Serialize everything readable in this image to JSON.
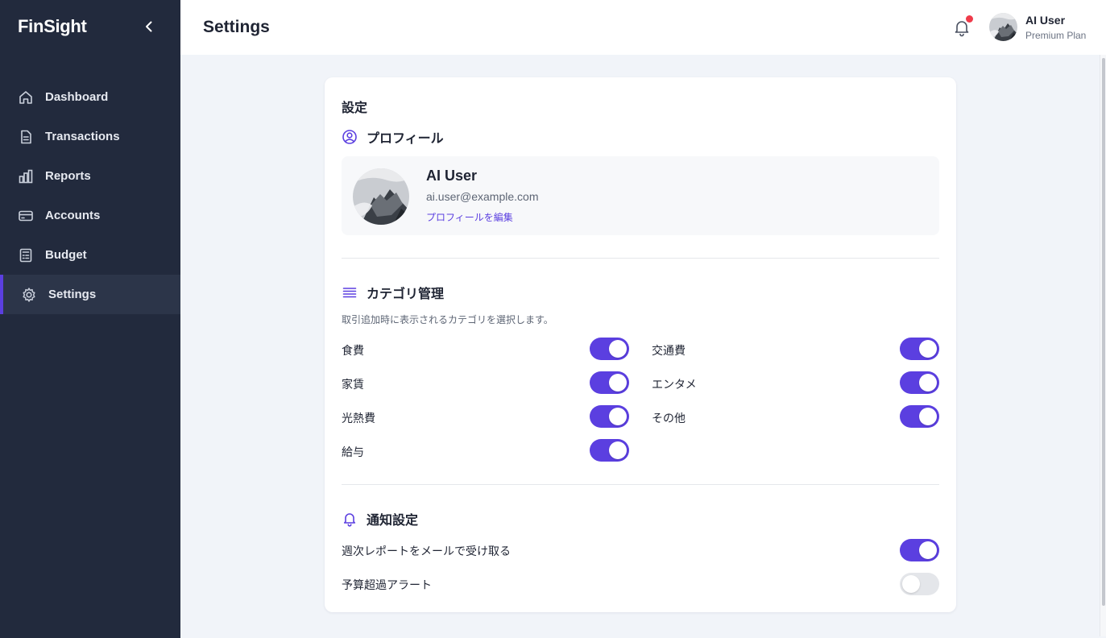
{
  "app": {
    "brand": "FinSight"
  },
  "sidebar": {
    "items": [
      {
        "label": "Dashboard",
        "icon": "home-icon",
        "active": false
      },
      {
        "label": "Transactions",
        "icon": "document-icon",
        "active": false
      },
      {
        "label": "Reports",
        "icon": "bar-chart-icon",
        "active": false
      },
      {
        "label": "Accounts",
        "icon": "credit-card-icon",
        "active": false
      },
      {
        "label": "Budget",
        "icon": "calculator-icon",
        "active": false
      },
      {
        "label": "Settings",
        "icon": "gear-icon",
        "active": true
      }
    ]
  },
  "header": {
    "title": "Settings",
    "notifications_unread": true,
    "user": {
      "name": "AI User",
      "plan": "Premium Plan"
    }
  },
  "settings": {
    "title": "設定",
    "profile": {
      "heading": "プロフィール",
      "name": "AI User",
      "email": "ai.user@example.com",
      "edit_label": "プロフィールを編集"
    },
    "categories": {
      "heading": "カテゴリ管理",
      "description": "取引追加時に表示されるカテゴリを選択します。",
      "items": [
        {
          "label": "食費",
          "enabled": true
        },
        {
          "label": "交通費",
          "enabled": true
        },
        {
          "label": "家賃",
          "enabled": true
        },
        {
          "label": "エンタメ",
          "enabled": true
        },
        {
          "label": "光熱費",
          "enabled": true
        },
        {
          "label": "その他",
          "enabled": true
        },
        {
          "label": "給与",
          "enabled": true
        }
      ]
    },
    "notifications": {
      "heading": "通知設定",
      "items": [
        {
          "label": "週次レポートをメールで受け取る",
          "enabled": true
        },
        {
          "label": "予算超過アラート",
          "enabled": false
        }
      ]
    }
  },
  "colors": {
    "accent": "#5b3fe0",
    "sidebar_bg": "#222a3d",
    "notification_dot": "#ef3b4a"
  }
}
